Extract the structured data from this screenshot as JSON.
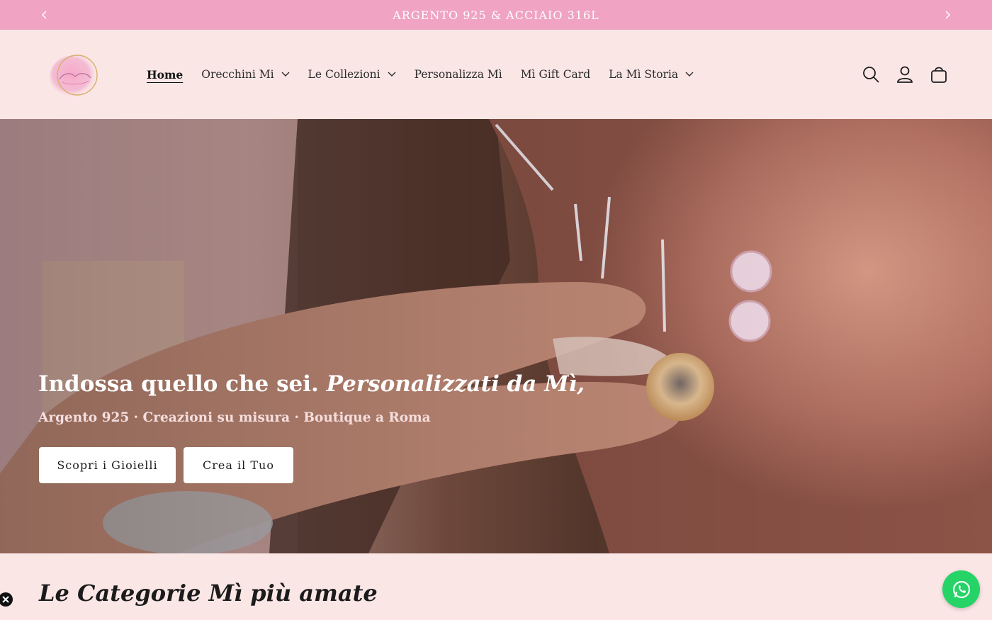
{
  "announcement": {
    "text": "ARGENTO 925 & ACCIAIO 316L",
    "prev_icon": "chevron-left-icon",
    "next_icon": "chevron-right-icon"
  },
  "header": {
    "logo_alt": "Mì logo",
    "nav": [
      {
        "label": "Home",
        "active": true,
        "has_dropdown": false
      },
      {
        "label": "Orecchini Mi",
        "active": false,
        "has_dropdown": true
      },
      {
        "label": "Le Collezioni",
        "active": false,
        "has_dropdown": true
      },
      {
        "label": "Personalizza Mì",
        "active": false,
        "has_dropdown": false
      },
      {
        "label": "Mì Gift Card",
        "active": false,
        "has_dropdown": false
      },
      {
        "label": "La Mì Storia",
        "active": false,
        "has_dropdown": true
      }
    ],
    "icons": [
      "search-icon",
      "account-icon",
      "cart-icon"
    ]
  },
  "hero": {
    "title_plain": "Indossa quello che sei.",
    "title_italic": "Personalizzati da Mì,",
    "subtitle": "Argento 925 · Creazioni su misura · Boutique a Roma",
    "button_primary": "Scopri i Gioielli",
    "button_secondary": "Crea il Tuo"
  },
  "section": {
    "title": "Le Categorie Mì più amate"
  },
  "colors": {
    "announcement_bg": "#f0a3c2",
    "page_bg": "#fbe6e6",
    "whatsapp": "#25d366"
  }
}
